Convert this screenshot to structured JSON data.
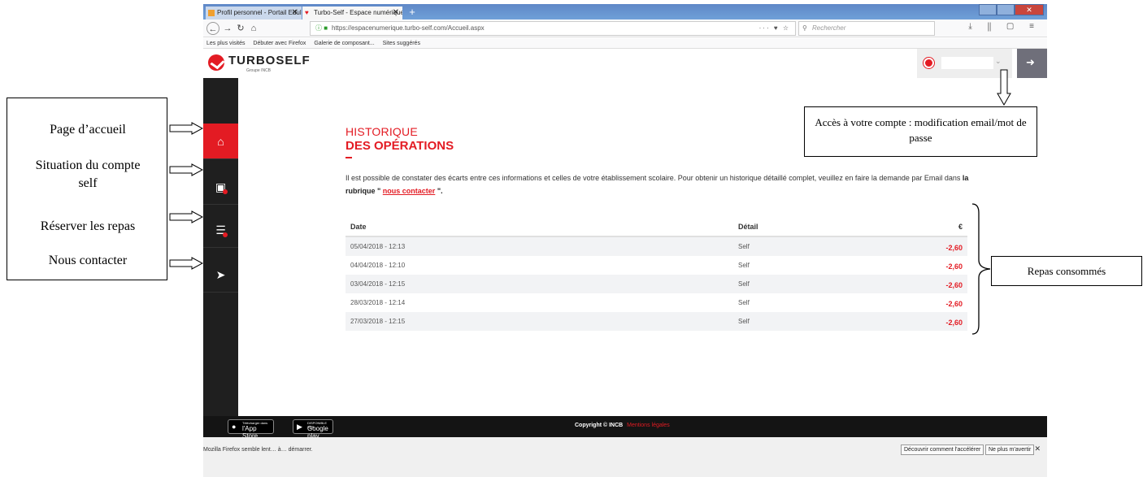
{
  "annotations": {
    "left_items": [
      "Page d’accueil",
      "Situation du compte self",
      "Réserver les repas",
      "Nous contacter"
    ],
    "account_callout": "Accès à votre compte : modification email/mot de passe",
    "meals_callout": "Repas consommés"
  },
  "browser": {
    "tabs": [
      {
        "label": "Profil personnel - Portail Edulo",
        "active": false
      },
      {
        "label": "Turbo-Self - Espace numérique",
        "active": true
      }
    ],
    "new_tab": "+",
    "url": "https://espacenumerique.turbo-self.com/Accueil.aspx",
    "url_actions": "··· ♥ ☆",
    "search_placeholder": "Rechercher",
    "bookmarks": [
      "Les plus visités",
      "Débuter avec Firefox",
      "Galerie de composant...",
      "Sites suggérés"
    ],
    "status_message": "Mozilla Firefox semble lent… à… démarrer.",
    "status_buttons": [
      "Découvrir comment l'accélérer",
      "Ne plus m'avertir"
    ]
  },
  "header": {
    "brand": "TURBOSELF",
    "brand_sub": "Groupe INCB"
  },
  "sidebar": {
    "items": [
      {
        "icon": "home-icon",
        "glyph": "⌂"
      },
      {
        "icon": "wallet-icon",
        "glyph": "▣"
      },
      {
        "icon": "menu-list-icon",
        "glyph": "☰"
      },
      {
        "icon": "paper-plane-icon",
        "glyph": "➤"
      }
    ]
  },
  "page": {
    "title_line1": "HISTORIQUE",
    "title_line2": "DES OPÉRATIONS",
    "intro_part1": "Il est possible de constater des écarts entre ces informations et celles de votre établissement scolaire. Pour obtenir un historique détaillé complet, veuillez en faire la demande par Email dans ",
    "intro_bold": "la rubrique \"",
    "intro_link": "nous contacter",
    "intro_end": "\"."
  },
  "table": {
    "headers": {
      "date": "Date",
      "detail": "Détail",
      "amount": "€"
    },
    "rows": [
      {
        "date": "05/04/2018 - 12:13",
        "detail": "Self",
        "amount": "-2,60"
      },
      {
        "date": "04/04/2018 - 12:10",
        "detail": "Self",
        "amount": "-2,60"
      },
      {
        "date": "03/04/2018 - 12:15",
        "detail": "Self",
        "amount": "-2,60"
      },
      {
        "date": "28/03/2018 - 12:14",
        "detail": "Self",
        "amount": "-2,60"
      },
      {
        "date": "27/03/2018 - 12:15",
        "detail": "Self",
        "amount": "-2,60"
      }
    ]
  },
  "footer": {
    "appstore_small": "Télécharger dans",
    "appstore_big": "l'App Store",
    "googleplay_small": "DISPONIBLE SUR",
    "googleplay_big": "Google play",
    "copyright": "Copyright © INCB",
    "legal": "Mentions légales"
  },
  "colors": {
    "accent": "#e31b23",
    "sidebar": "#1f1f1f",
    "footer": "#141414"
  }
}
